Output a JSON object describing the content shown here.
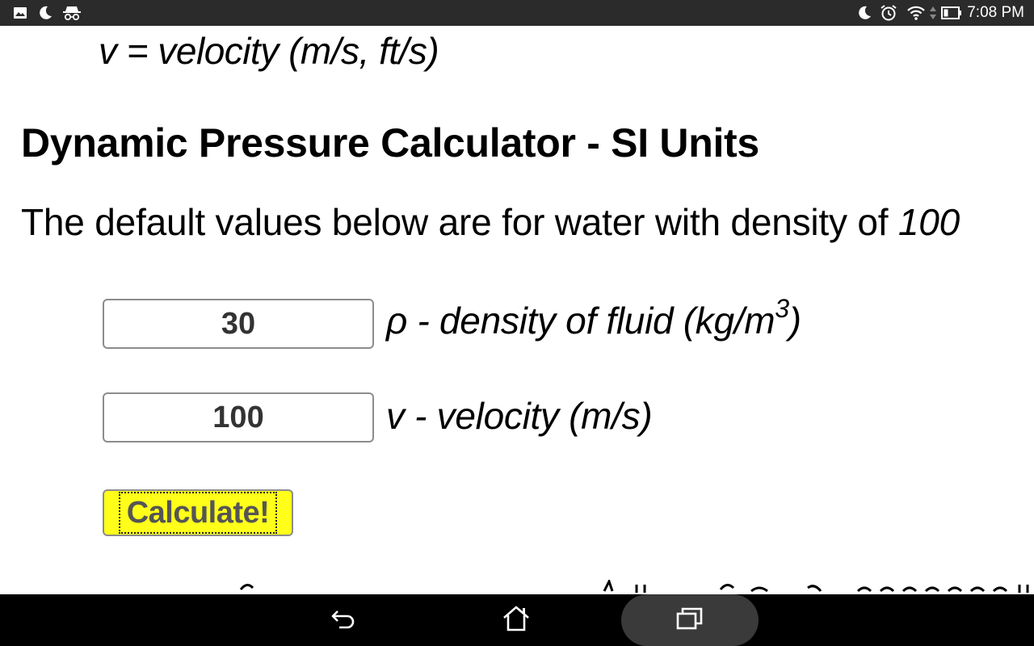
{
  "status_bar": {
    "left_icons": [
      "image-icon",
      "moon-icon",
      "incognito-icon"
    ],
    "right_icons": [
      "moon-icon",
      "alarm-icon",
      "wifi-icon",
      "battery-icon"
    ],
    "time": "7:08 PM"
  },
  "content": {
    "velocity_definition": "v = velocity (m/s, ft/s)",
    "heading": "Dynamic Pressure Calculator - SI Units",
    "intro": "The default values below are for water with density of ",
    "intro_italic": "100",
    "density_field": {
      "value": "30",
      "label_prefix": "ρ - density of fluid (kg/m",
      "label_sup": "3",
      "label_suffix": ")"
    },
    "velocity_field": {
      "value": "100",
      "label": "v - velocity (m/s)"
    },
    "calculate_label": "Calculate!"
  },
  "nav_bar": {
    "buttons": [
      "back-icon",
      "home-icon",
      "recents-icon"
    ]
  }
}
